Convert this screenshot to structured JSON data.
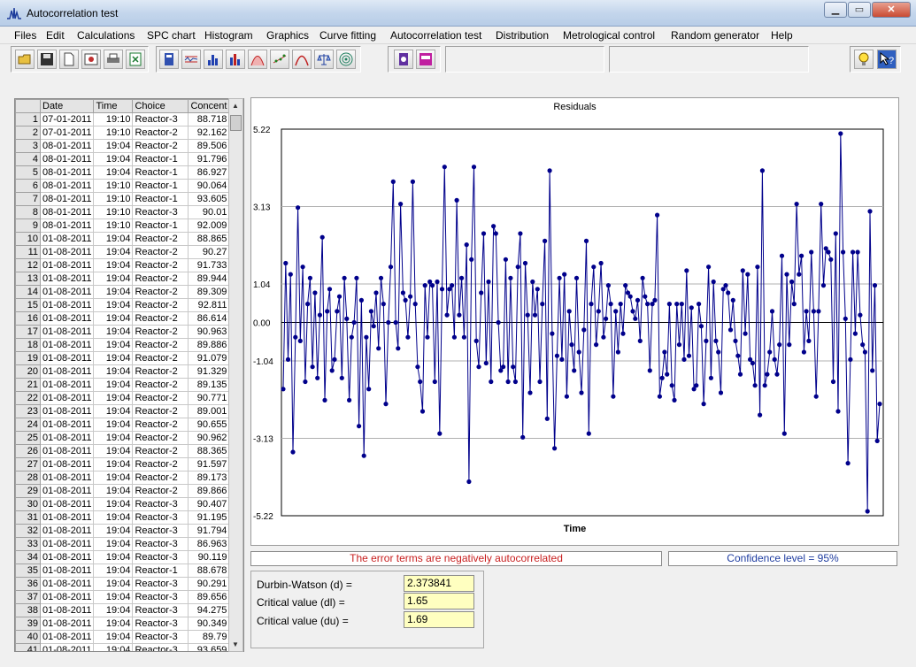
{
  "window": {
    "title": "Autocorrelation test",
    "min_glyph": "▁",
    "max_glyph": "▭",
    "close_glyph": "✕"
  },
  "menu": [
    "Files",
    "Edit",
    "Calculations",
    "SPC chart",
    "Histogram",
    "Graphics",
    "Curve fitting",
    "Autocorrelation test",
    "Distribution",
    "Metrological control",
    "Random generator",
    "Help"
  ],
  "toolbar": {
    "icons": [
      "open-folder-icon",
      "save-icon",
      "new-file-icon",
      "image-icon",
      "print-icon",
      "export-icon",
      "calculator-icon",
      "spc-chart-icon",
      "histogram-icon",
      "bar-chart-icon",
      "distribution-icon",
      "curve-fitting-icon",
      "bell-curve-icon",
      "balance-icon",
      "target-icon",
      "metrology-icon",
      "random-generator-icon",
      "lightbulb-icon",
      "help-icon"
    ]
  },
  "grid": {
    "columns": [
      "Date",
      "Time",
      "Choice",
      "Concent"
    ],
    "rows": [
      {
        "n": "1",
        "date": "07-01-2011",
        "time": "19:10",
        "choice": "Reactor-3",
        "conc": "88.718"
      },
      {
        "n": "2",
        "date": "07-01-2011",
        "time": "19:10",
        "choice": "Reactor-2",
        "conc": "92.162"
      },
      {
        "n": "3",
        "date": "08-01-2011",
        "time": "19:04",
        "choice": "Reactor-2",
        "conc": "89.506"
      },
      {
        "n": "4",
        "date": "08-01-2011",
        "time": "19:04",
        "choice": "Reactor-1",
        "conc": "91.796"
      },
      {
        "n": "5",
        "date": "08-01-2011",
        "time": "19:04",
        "choice": "Reactor-1",
        "conc": "86.927"
      },
      {
        "n": "6",
        "date": "08-01-2011",
        "time": "19:10",
        "choice": "Reactor-1",
        "conc": "90.064"
      },
      {
        "n": "7",
        "date": "08-01-2011",
        "time": "19:10",
        "choice": "Reactor-1",
        "conc": "93.605"
      },
      {
        "n": "8",
        "date": "08-01-2011",
        "time": "19:10",
        "choice": "Reactor-3",
        "conc": "90.01"
      },
      {
        "n": "9",
        "date": "08-01-2011",
        "time": "19:10",
        "choice": "Reactor-1",
        "conc": "92.009"
      },
      {
        "n": "10",
        "date": "01-08-2011",
        "time": "19:04",
        "choice": "Reactor-2",
        "conc": "88.865"
      },
      {
        "n": "11",
        "date": "01-08-2011",
        "time": "19:04",
        "choice": "Reactor-2",
        "conc": "90.27"
      },
      {
        "n": "12",
        "date": "01-08-2011",
        "time": "19:04",
        "choice": "Reactor-2",
        "conc": "91.733"
      },
      {
        "n": "13",
        "date": "01-08-2011",
        "time": "19:04",
        "choice": "Reactor-2",
        "conc": "89.944"
      },
      {
        "n": "14",
        "date": "01-08-2011",
        "time": "19:04",
        "choice": "Reactor-2",
        "conc": "89.309"
      },
      {
        "n": "15",
        "date": "01-08-2011",
        "time": "19:04",
        "choice": "Reactor-2",
        "conc": "92.811"
      },
      {
        "n": "16",
        "date": "01-08-2011",
        "time": "19:04",
        "choice": "Reactor-2",
        "conc": "86.614"
      },
      {
        "n": "17",
        "date": "01-08-2011",
        "time": "19:04",
        "choice": "Reactor-2",
        "conc": "90.963"
      },
      {
        "n": "18",
        "date": "01-08-2011",
        "time": "19:04",
        "choice": "Reactor-2",
        "conc": "89.886"
      },
      {
        "n": "19",
        "date": "01-08-2011",
        "time": "19:04",
        "choice": "Reactor-2",
        "conc": "91.079"
      },
      {
        "n": "20",
        "date": "01-08-2011",
        "time": "19:04",
        "choice": "Reactor-2",
        "conc": "91.329"
      },
      {
        "n": "21",
        "date": "01-08-2011",
        "time": "19:04",
        "choice": "Reactor-2",
        "conc": "89.135"
      },
      {
        "n": "22",
        "date": "01-08-2011",
        "time": "19:04",
        "choice": "Reactor-2",
        "conc": "90.771"
      },
      {
        "n": "23",
        "date": "01-08-2011",
        "time": "19:04",
        "choice": "Reactor-2",
        "conc": "89.001"
      },
      {
        "n": "24",
        "date": "01-08-2011",
        "time": "19:04",
        "choice": "Reactor-2",
        "conc": "90.655"
      },
      {
        "n": "25",
        "date": "01-08-2011",
        "time": "19:04",
        "choice": "Reactor-2",
        "conc": "90.962"
      },
      {
        "n": "26",
        "date": "01-08-2011",
        "time": "19:04",
        "choice": "Reactor-2",
        "conc": "88.365"
      },
      {
        "n": "27",
        "date": "01-08-2011",
        "time": "19:04",
        "choice": "Reactor-2",
        "conc": "91.597"
      },
      {
        "n": "28",
        "date": "01-08-2011",
        "time": "19:04",
        "choice": "Reactor-2",
        "conc": "89.173"
      },
      {
        "n": "29",
        "date": "01-08-2011",
        "time": "19:04",
        "choice": "Reactor-2",
        "conc": "89.866"
      },
      {
        "n": "30",
        "date": "01-08-2011",
        "time": "19:04",
        "choice": "Reactor-3",
        "conc": "90.407"
      },
      {
        "n": "31",
        "date": "01-08-2011",
        "time": "19:04",
        "choice": "Reactor-3",
        "conc": "91.195"
      },
      {
        "n": "32",
        "date": "01-08-2011",
        "time": "19:04",
        "choice": "Reactor-3",
        "conc": "91.794"
      },
      {
        "n": "33",
        "date": "01-08-2011",
        "time": "19:04",
        "choice": "Reactor-3",
        "conc": "86.963"
      },
      {
        "n": "34",
        "date": "01-08-2011",
        "time": "19:04",
        "choice": "Reactor-3",
        "conc": "90.119"
      },
      {
        "n": "35",
        "date": "01-08-2011",
        "time": "19:04",
        "choice": "Reactor-1",
        "conc": "88.678"
      },
      {
        "n": "36",
        "date": "01-08-2011",
        "time": "19:04",
        "choice": "Reactor-3",
        "conc": "90.291"
      },
      {
        "n": "37",
        "date": "01-08-2011",
        "time": "19:04",
        "choice": "Reactor-3",
        "conc": "89.656"
      },
      {
        "n": "38",
        "date": "01-08-2011",
        "time": "19:04",
        "choice": "Reactor-3",
        "conc": "94.275"
      },
      {
        "n": "39",
        "date": "01-08-2011",
        "time": "19:04",
        "choice": "Reactor-3",
        "conc": "90.349"
      },
      {
        "n": "40",
        "date": "01-08-2011",
        "time": "19:04",
        "choice": "Reactor-3",
        "conc": "89.79"
      },
      {
        "n": "41",
        "date": "01-08-2011",
        "time": "19:04",
        "choice": "Reactor-3",
        "conc": "93.659"
      }
    ]
  },
  "chart_data": {
    "type": "line",
    "title": "Residuals",
    "xlabel": "Time",
    "ylabel": "",
    "ylim": [
      -5.22,
      5.22
    ],
    "yticks": [
      "5.22",
      "3.13",
      "1.04",
      "0.00",
      "-1.04",
      "-3.13",
      "-5.22"
    ],
    "ytick_values": [
      5.22,
      3.13,
      1.04,
      0.0,
      -1.04,
      -3.13,
      -5.22
    ],
    "grid": true,
    "line_color": "#00008b",
    "series": [
      {
        "values": [
          -1.8,
          1.6,
          -1.0,
          1.3,
          -3.5,
          -0.4,
          3.1,
          -0.5,
          1.5,
          -1.6,
          0.5,
          1.2,
          -1.2,
          0.8,
          -1.5,
          0.2,
          2.3,
          -2.1,
          0.3,
          0.9,
          -1.3,
          -1.0,
          0.3,
          0.7,
          -1.5,
          1.2,
          0.1,
          -2.1,
          -0.4,
          0.0,
          1.2,
          -2.8,
          0.6,
          -3.6,
          -0.4,
          -1.8,
          0.3,
          -0.1,
          0.8,
          -0.7,
          1.2,
          0.5,
          -2.2,
          0.0,
          1.5,
          3.8,
          0.0,
          -0.7,
          3.2,
          0.8,
          0.6,
          -0.4,
          0.7,
          3.8,
          0.5,
          -1.2,
          -1.6,
          -2.4,
          1.0,
          -0.4,
          1.1,
          1.0,
          -1.6,
          1.1,
          -3.0,
          0.9,
          4.2,
          0.2,
          0.9,
          1.0,
          -0.4,
          3.3,
          0.2,
          1.2,
          -0.4,
          2.1,
          -4.3,
          1.7,
          4.2,
          -0.5,
          -1.2,
          0.8,
          2.4,
          -1.1,
          1.1,
          -1.6,
          2.6,
          2.4,
          0.0,
          -1.3,
          -1.2,
          1.7,
          -1.6,
          1.2,
          -1.2,
          -1.6,
          1.5,
          2.4,
          -3.1,
          1.6,
          0.2,
          -1.9,
          1.1,
          0.2,
          0.9,
          -1.6,
          0.5,
          2.2,
          -2.6,
          4.1,
          -0.3,
          -3.4,
          -0.9,
          1.2,
          -1.0,
          1.3,
          -2.0,
          0.3,
          -0.6,
          -1.3,
          1.2,
          -0.8,
          -1.9,
          -0.2,
          2.2,
          -3.0,
          0.5,
          1.5,
          -0.6,
          0.3,
          1.6,
          -0.4,
          0.1,
          1.0,
          0.5,
          -2.0,
          0.3,
          -0.8,
          0.5,
          -0.3,
          1.0,
          0.8,
          0.7,
          0.3,
          0.1,
          0.6,
          -0.5,
          1.2,
          0.7,
          0.5,
          -1.3,
          0.5,
          0.6,
          2.9,
          -2.0,
          -1.5,
          -0.8,
          -1.4,
          0.5,
          -1.7,
          -2.1,
          0.5,
          -0.6,
          0.5,
          -1.0,
          1.4,
          -0.9,
          0.4,
          -1.8,
          -1.7,
          0.5,
          -0.1,
          -2.2,
          -0.5,
          1.5,
          -1.5,
          1.1,
          -0.5,
          -0.8,
          -1.9,
          0.9,
          1.0,
          0.8,
          -0.2,
          0.6,
          -0.5,
          -0.9,
          -1.4,
          1.4,
          -0.3,
          1.3,
          -1.0,
          -1.1,
          -1.7,
          1.5,
          -2.5,
          4.1,
          -1.7,
          -1.4,
          -0.8,
          0.3,
          -1.0,
          -1.4,
          -0.6,
          1.8,
          -3.0,
          1.3,
          -0.6,
          1.1,
          0.5,
          3.2,
          1.3,
          1.8,
          -0.8,
          0.3,
          -0.5,
          1.9,
          0.3,
          -2.0,
          0.3,
          3.2,
          1.0,
          2.0,
          1.9,
          1.7,
          -1.6,
          2.4,
          -2.4,
          5.1,
          1.9,
          0.1,
          -3.8,
          -1.0,
          1.9,
          -0.3,
          1.9,
          0.2,
          -0.6,
          -0.8,
          -5.1,
          3.0,
          -1.3,
          1.0,
          -3.2,
          -2.2
        ]
      }
    ]
  },
  "status": {
    "conclusion": "The error terms are negatively autocorrelated",
    "confidence": "Confidence level = 95%"
  },
  "stats": {
    "dw_label": "Durbin-Watson  (d)   =",
    "dw_value": "2.373841",
    "dl_label": "Critical value (dl)  =",
    "dl_value": "1.65",
    "du_label": "Critical value (du)  =",
    "du_value": "1.69"
  }
}
